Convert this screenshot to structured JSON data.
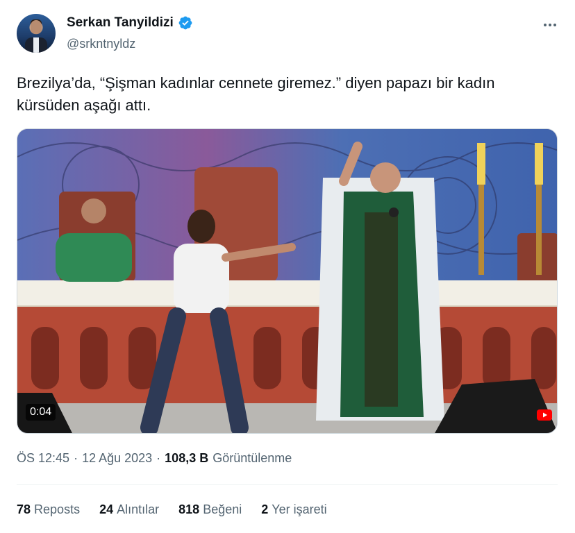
{
  "author": {
    "name": "Serkan Tanyildizi",
    "handle": "@srkntnyldz",
    "verified_color": "#1d9bf0"
  },
  "tweet": {
    "text": "Brezilya’da, “Şişman kadınlar cennete giremez.” diyen papazı bir kadın kürsüden aşağı attı."
  },
  "media": {
    "type": "video",
    "duration": "0:04",
    "icons": [
      "youtube-logo-icon"
    ]
  },
  "meta": {
    "time": "ÖS 12:45",
    "sep1": "·",
    "date": "12 Ağu 2023",
    "sep2": "·",
    "views_count": "108,3 B",
    "views_label": "Görüntülenme"
  },
  "stats": [
    {
      "count": "78",
      "label": "Reposts"
    },
    {
      "count": "24",
      "label": "Alıntılar"
    },
    {
      "count": "818",
      "label": "Beğeni"
    },
    {
      "count": "2",
      "label": "Yer işareti"
    }
  ],
  "icons": {
    "more": "more-dots-icon",
    "verified": "verified-badge-icon"
  }
}
